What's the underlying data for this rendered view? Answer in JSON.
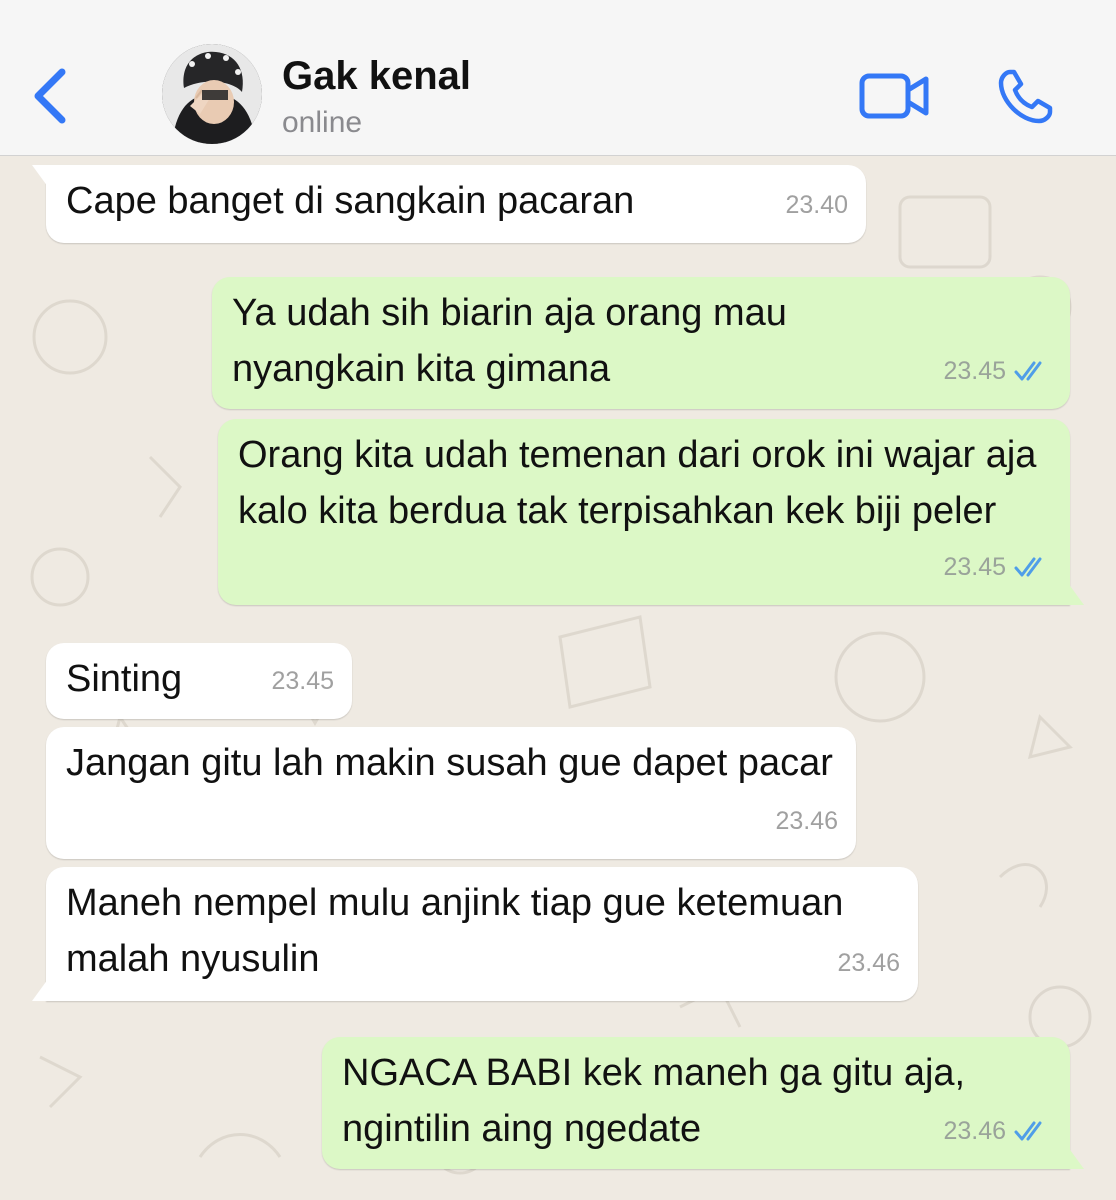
{
  "header": {
    "contact_name": "Gak kenal",
    "status": "online",
    "back_icon": "chevron-left-icon",
    "video_icon": "video-camera-icon",
    "call_icon": "phone-icon",
    "accent_color": "#3478f6"
  },
  "colors": {
    "incoming_bubble": "#ffffff",
    "outgoing_bubble": "#dcf8c6",
    "read_ticks": "#4f9ee8",
    "wallpaper": "#efeae2"
  },
  "messages": [
    {
      "direction": "incoming",
      "text": "Cape banget di sangkain pacaran",
      "time": "23.40"
    },
    {
      "direction": "outgoing",
      "text": "Ya udah sih biarin aja orang mau nyangkain kita gimana",
      "time": "23.45",
      "status": "read"
    },
    {
      "direction": "outgoing",
      "text": "Orang kita udah temenan dari orok ini wajar aja kalo kita berdua tak terpisahkan kek biji peler",
      "time": "23.45",
      "status": "read"
    },
    {
      "direction": "incoming",
      "text": "Sinting",
      "time": "23.45"
    },
    {
      "direction": "incoming",
      "text": "Jangan gitu lah makin susah gue dapet pacar",
      "time": "23.46"
    },
    {
      "direction": "incoming",
      "text": "Maneh nempel mulu anjink tiap gue ketemuan malah nyusulin",
      "time": "23.46"
    },
    {
      "direction": "outgoing",
      "text": "NGACA BABI kek maneh ga gitu aja, ngintilin aing ngedate",
      "time": "23.46",
      "status": "read"
    }
  ]
}
